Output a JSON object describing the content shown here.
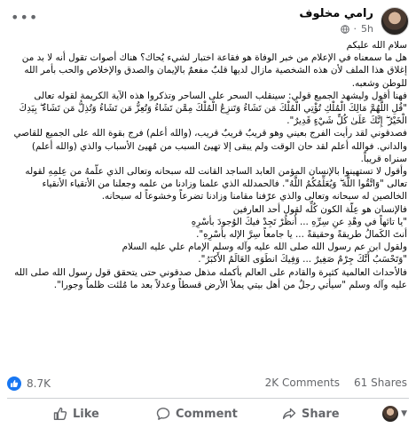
{
  "post": {
    "author": "رامي مخلوف",
    "time": "5h",
    "paragraphs": [
      "سلام الله عليكم",
      "هل ما سمعناه في الإعلام من خبر الوفاة هو فقاعة اختبار لشيء يُحاك؟ هناك أصوات تقول أنه لا بد من إغلاق هذا الملف لأن هذه الشخصية مازال لديها قلبٌ مفعمٌ بالإيمان والصدق والإخلاص والحب بأمر الله للوطن وشعبه.",
      "فهنا أقول وليشهد الجميع قولي: سينقلب السحر على الساحر وتذكروا هذه الآية الكريمة لقوله تعالى",
      "\"قُلِ اللَّهُمَّ مَالِكَ الْمُلْكِ تُؤْتِي الْمُلْكَ مَن تَشَاءُ وَتَنزِعُ الْمُلْكَ مِمَّن تَشَاءُ وَتُعِزُّ مَن تَشَاءُ وَتُذِلُّ مَن تَشَاءُ ۖ بِيَدِكَ الْخَيْرُ ۖ إِنَّكَ عَلَىٰ كُلِّ شَيْءٍ قَدِيرٌ\".",
      "فصدقوني لقد رأيت الفرج بعيني وهو قريبٌ قريبٌ قريب، (والله أعلم) فرج بقوة الله على الجميع للقاصي والداني. فوالله أعلم لقد حان الوقت ولم يبقى إلا تهيئ السبب من مُهيئ الأسباب والذي (والله أعلم) سنراه قريباً.",
      "وأقول لا تستهينوا بالإنسان المؤمن العابد الساجد القانت لله سبحانه وتعالى الذي علّمهُ من عِلمِهِ لقوله تعالى \"وَاتَّقُوا اللَّهَ ۖ وَيُعَلِّمُكُمُ اللَّهُ\". فالحمدلله الذي علمنا وزادنا من علمه وجعلنا من الأتقياء الأنقياء الخالصين له سبحانه وتعالى والذي عرّفنا مقامنا وزادنا تضرعاً وخشوعاً له سبحانه.",
      "فالإنسان هو عِلّة الكون كُلِّه لقول أحد العارفين",
      "\"يا تائهاً في وهْدِ عنِ سِرِّهِ ... أُنظُرْ تَجِدْ فيكَ الوُجودَ بأسْرِهِ",
      "أنتَ الكَمالُ طريقةً وحقيقةً ... يا جامعاً سِرَّ الإله بأسْرِهِ\".",
      "ولقول ابن عم رسول الله صلى الله عليه وآله وسلم الإمام علي عليه السلام",
      "\"وَتَحْسَبُ أَنَّكَ جِرْمٌ صَغِيرٌ ... وَفِيكَ انطَوَى العَالَمُ الأَكبَرُ\".",
      "فالأحداث العالمية كثيرة والقادم على العالم بأكمله مذهل صدقوني حتى يتحقق قول رسول الله صلى الله عليه وآله وسلم \"سيأتي رجلٌ من أهل بيتي يملأ الأرض قسطاً وعدلاً بعد ما مُلئت ظلماً وجورا\"."
    ]
  },
  "stats": {
    "reactions": "8.7K",
    "comments": "2K Comments",
    "shares": "61 Shares"
  },
  "actions": {
    "like": "Like",
    "comment": "Comment",
    "share": "Share"
  },
  "colors": {
    "accent": "#1877f2",
    "muted": "#65676b",
    "divider": "#ced0d4"
  },
  "icons": [
    "more-icon",
    "globe-icon",
    "like-icon",
    "comment-icon",
    "share-icon",
    "avatar"
  ]
}
